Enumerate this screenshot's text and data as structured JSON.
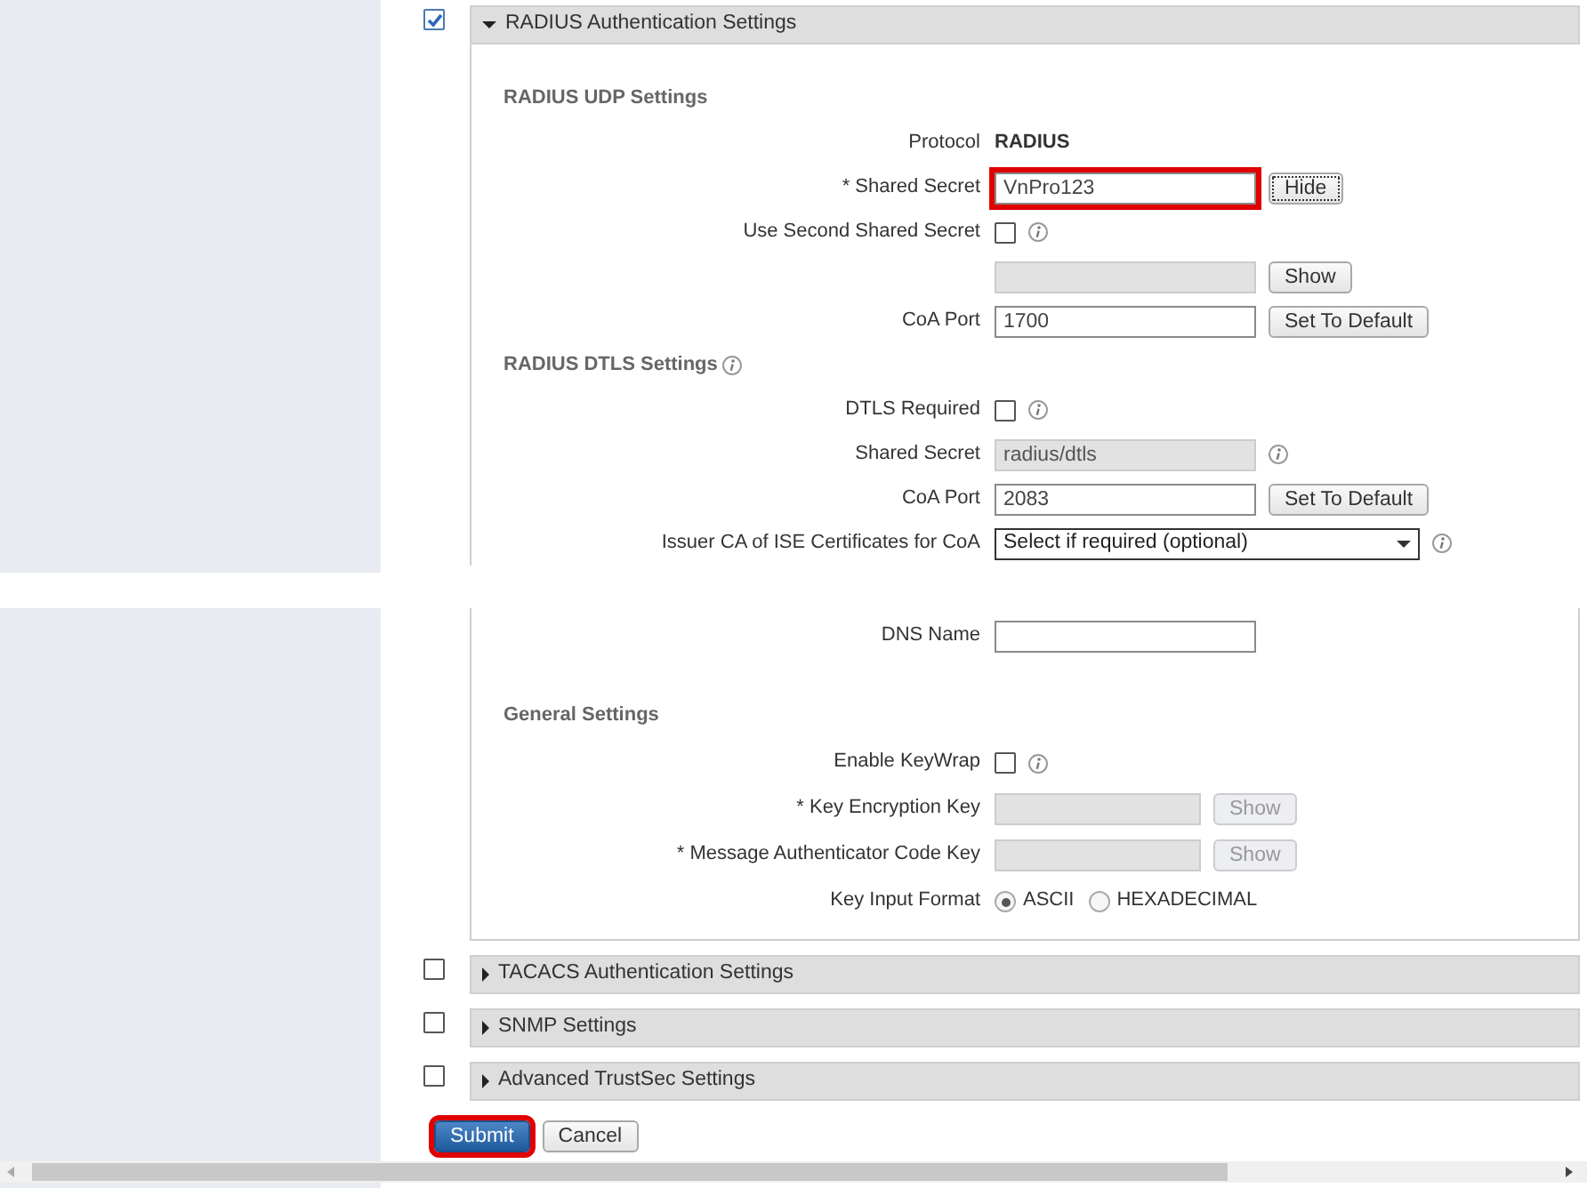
{
  "radius_section": {
    "title": "RADIUS Authentication Settings",
    "checked": true,
    "expanded": true,
    "udp": {
      "heading": "RADIUS UDP Settings",
      "info": false,
      "rows": [
        {
          "kind": "text",
          "label": "Protocol",
          "value": "RADIUS"
        },
        {
          "kind": "field",
          "label": "* Shared Secret",
          "value": "VnPro123",
          "disabled": false,
          "highlighted": true,
          "button": {
            "label": "Hide",
            "disabled": false,
            "focused": true
          }
        },
        {
          "kind": "checkbox",
          "label": "Use Second Shared Secret",
          "checked": false,
          "info": true
        },
        {
          "kind": "field",
          "disabled": true,
          "highlighted": false,
          "button": {
            "label": "Show",
            "disabled": false,
            "focused": false
          }
        },
        {
          "kind": "field",
          "label": "CoA Port",
          "value": "1700",
          "disabled": false,
          "highlighted": false,
          "button": {
            "label": "Set To Default",
            "disabled": false,
            "focused": false
          }
        }
      ]
    },
    "dtls": {
      "heading": "RADIUS DTLS Settings",
      "info": true,
      "rows": [
        {
          "kind": "checkbox",
          "label": "DTLS Required",
          "checked": false,
          "info": true
        },
        {
          "kind": "field",
          "label": "Shared Secret",
          "value": "radius/dtls",
          "disabled": true,
          "highlighted": false,
          "info": true
        },
        {
          "kind": "field",
          "label": "CoA Port",
          "value": "2083",
          "disabled": false,
          "highlighted": false,
          "button": {
            "label": "Set To Default",
            "disabled": false,
            "focused": false
          }
        },
        {
          "kind": "select",
          "label": "Issuer CA of ISE Certificates for CoA",
          "value": "Select if required (optional)",
          "info": true
        }
      ]
    },
    "continued": {
      "rows": [
        {
          "kind": "field",
          "label": "DNS Name",
          "disabled": false,
          "highlighted": false
        }
      ]
    },
    "general": {
      "heading": "General Settings",
      "info": false,
      "rows": [
        {
          "kind": "checkbox",
          "label": "Enable KeyWrap",
          "checked": false,
          "info": true
        },
        {
          "kind": "field",
          "label": "*  Key Encryption Key",
          "disabled": true,
          "highlighted": false,
          "button": {
            "label": "Show",
            "disabled": true,
            "focused": false
          }
        },
        {
          "kind": "field",
          "label": "*  Message Authenticator Code Key",
          "disabled": true,
          "highlighted": false,
          "button": {
            "label": "Show",
            "disabled": true,
            "focused": false
          }
        },
        {
          "kind": "radio",
          "label": "Key Input Format",
          "options": [
            {
              "label": "ASCII",
              "selected": true
            },
            {
              "label": "HEXADECIMAL",
              "selected": false
            }
          ]
        }
      ]
    }
  },
  "other_sections": [
    {
      "title": "TACACS Authentication Settings",
      "checked": false,
      "expanded": false
    },
    {
      "title": "SNMP Settings",
      "checked": false,
      "expanded": false
    },
    {
      "title": "Advanced TrustSec Settings",
      "checked": false,
      "expanded": false
    }
  ],
  "buttons": [
    {
      "label": "Submit",
      "primary": true,
      "highlighted": true
    },
    {
      "label": "Cancel",
      "primary": false,
      "highlighted": false
    }
  ]
}
